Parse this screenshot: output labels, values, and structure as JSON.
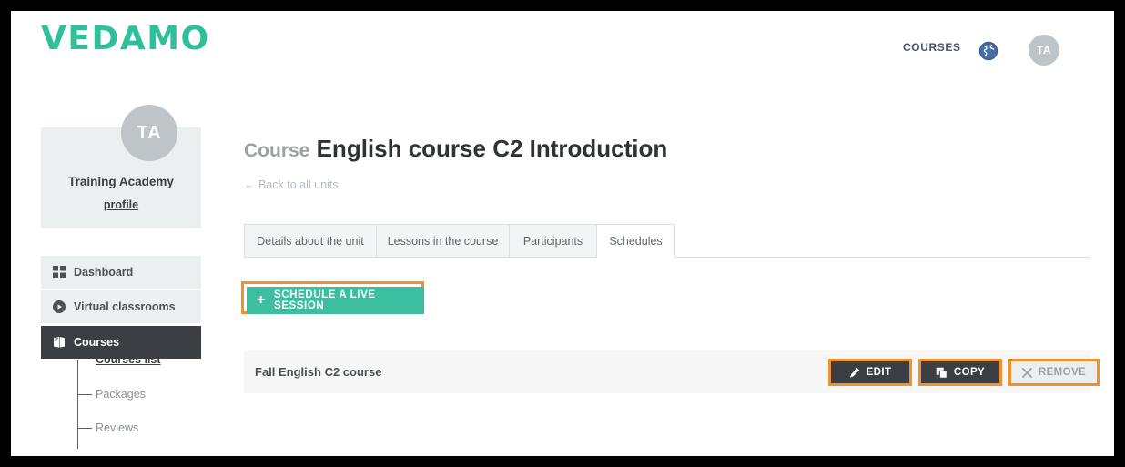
{
  "brand": {
    "logo_text": "VEDAMO",
    "logo_color": "#2fbf9a"
  },
  "header": {
    "nav_courses_label": "COURSES",
    "language_icon": "globe-icon",
    "avatar_initials": "TA"
  },
  "sidebar": {
    "profile": {
      "avatar_initials": "TA",
      "name": "Training Academy",
      "link_label": "profile"
    },
    "items": [
      {
        "label": "Dashboard",
        "icon": "grid-icon",
        "active": false
      },
      {
        "label": "Virtual classrooms",
        "icon": "play-circle-icon",
        "active": false
      },
      {
        "label": "Courses",
        "icon": "book-icon",
        "active": true
      }
    ],
    "sub_items": [
      {
        "label": "Courses list",
        "active": true
      },
      {
        "label": "Packages",
        "active": false
      },
      {
        "label": "Reviews",
        "active": false
      }
    ]
  },
  "main": {
    "title_kicker": "Course",
    "title": "English course C2 Introduction",
    "back_link": "← Back to all units",
    "tabs": [
      {
        "label": "Details about the unit",
        "active": false
      },
      {
        "label": "Lessons in the course",
        "active": false
      },
      {
        "label": "Participants",
        "active": false
      },
      {
        "label": "Schedules",
        "active": true
      }
    ],
    "schedule_button": {
      "label": "SCHEDULE A LIVE SESSION",
      "plus": "+",
      "color": "#3cbfa0",
      "highlight_color": "#f2912a"
    },
    "schedule_rows": [
      {
        "title": "Fall English C2 course",
        "actions": [
          {
            "label": "EDIT",
            "icon": "pencil-icon",
            "style": "dark"
          },
          {
            "label": "COPY",
            "icon": "copy-icon",
            "style": "dark"
          },
          {
            "label": "REMOVE",
            "icon": "close-x-icon",
            "style": "light"
          }
        ]
      }
    ]
  }
}
